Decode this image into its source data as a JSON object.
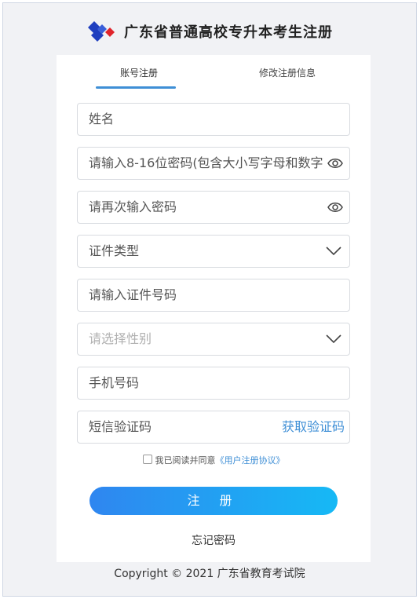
{
  "header": {
    "title": "广东省普通高校专升本考生注册",
    "logo_icon": "diamond-logo-icon"
  },
  "tabs": [
    {
      "label": "账号注册",
      "active": true
    },
    {
      "label": "修改注册信息",
      "active": false
    }
  ],
  "form": {
    "name": {
      "placeholder": "姓名"
    },
    "password": {
      "placeholder": "请输入8-16位密码(包含大小写字母和数字)",
      "icon": "eye-icon"
    },
    "password_confirm": {
      "placeholder": "请再次输入密码",
      "icon": "eye-icon"
    },
    "id_type": {
      "placeholder": "证件类型",
      "icon": "chevron-down-icon"
    },
    "id_number": {
      "placeholder": "请输入证件号码"
    },
    "gender": {
      "placeholder": "请选择性别",
      "icon": "chevron-down-icon"
    },
    "phone": {
      "placeholder": "手机号码"
    },
    "sms_code": {
      "placeholder": "短信验证码",
      "action": "获取验证码"
    }
  },
  "agreement": {
    "text": "我已阅读并同意",
    "link": "《用户注册协议》",
    "checked": false
  },
  "submit_label": "注 册",
  "forgot_label": "忘记密码",
  "footer": "Copyright © 2021 广东省教育考试院",
  "colors": {
    "accent": "#3f8fd6",
    "button_start": "#2f86f0",
    "button_end": "#16b9f5",
    "logo_blue": "#1f3fbf",
    "logo_red": "#e0242b"
  }
}
